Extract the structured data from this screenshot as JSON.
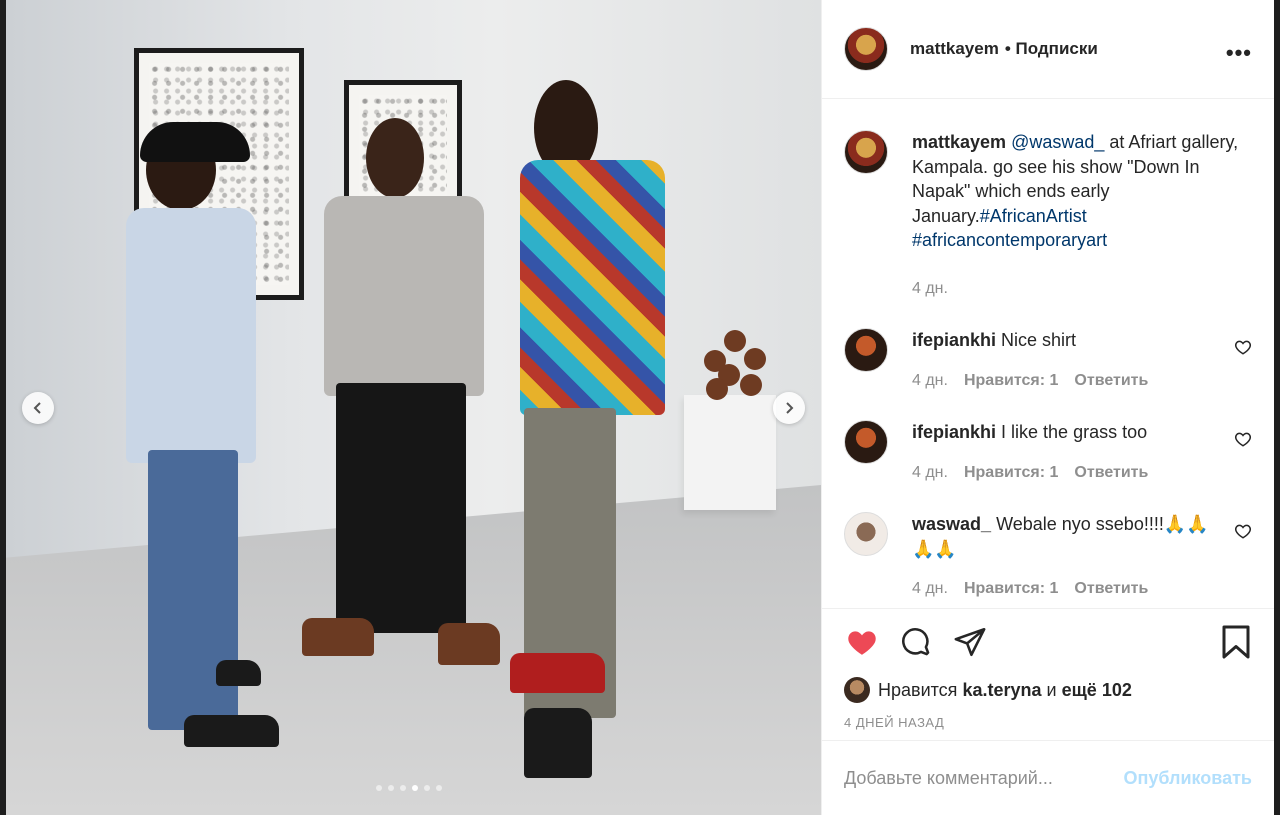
{
  "post": {
    "author": "mattkayem",
    "follow_status": "• Подписки",
    "more_icon": "more-horizontal-icon",
    "photo": {
      "alt_objects": [
        "three men talking in art gallery",
        "framed drawings on wall",
        "wooden sculpture on pedestal"
      ],
      "carousel_dots": 6,
      "active_dot": 3
    }
  },
  "caption": {
    "author": "mattkayem",
    "mention": "@waswad_",
    "text": " at Afriart gallery, Kampala. go see his show \"Down In Napak\" which ends early January.",
    "tag1": "#AfricanArtist",
    "tag2": "#africancontemporaryart",
    "time": "4 дн."
  },
  "comments": [
    {
      "author": "ifepiankhi",
      "text": "Nice shirt",
      "time": "4 дн.",
      "likes": "Нравится: 1",
      "reply": "Ответить"
    },
    {
      "author": "ifepiankhi",
      "text": "I like the grass too",
      "time": "4 дн.",
      "likes": "Нравится: 1",
      "reply": "Ответить"
    },
    {
      "author": "waswad_",
      "text": "Webale nyo ssebo!!!!🙏🙏🙏🙏",
      "time": "4 дн.",
      "likes": "Нравится: 1",
      "reply": "Ответить"
    }
  ],
  "actions": {
    "likes_prefix": "Нравится",
    "liker": "ka.teryna",
    "likes_and": "и",
    "likes_more": "ещё 102",
    "posted_ago": "4 ДНЕЙ НАЗАД",
    "comment_placeholder": "Добавьте комментарий...",
    "publish_label": "Опубликовать"
  },
  "colors": {
    "like_red": "#ed4956",
    "link_blue": "#00376b",
    "publish_disabled": "#b2dffc"
  }
}
